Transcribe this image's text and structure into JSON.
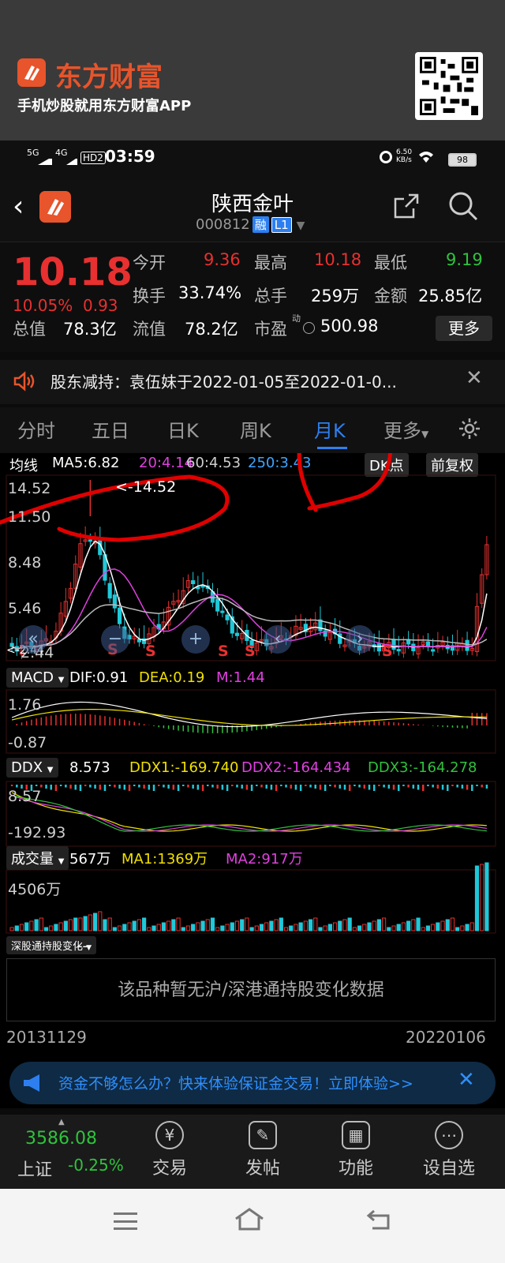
{
  "banner": {
    "brand": "东方财富",
    "slogan": "手机炒股就用东方财富APP"
  },
  "status_bar": {
    "net1": "5G",
    "net2": "4G",
    "hd": "HD2",
    "time": "03:59",
    "speed": "6.50 KB/s",
    "battery": "98"
  },
  "header": {
    "title": "陕西金叶",
    "code": "000812",
    "tag_margin": "融",
    "tag_level": "L1"
  },
  "quote": {
    "price": "10.18",
    "change_pct": "10.05%",
    "change": "0.93",
    "labels": [
      "今开",
      "最高",
      "最低",
      "换手",
      "总手",
      "金额",
      "总值",
      "流值",
      "市盈"
    ],
    "open": "9.36",
    "high": "10.18",
    "low": "9.19",
    "turnover": "33.74%",
    "volume": "259万",
    "amount": "25.85亿",
    "market_cap": "78.3亿",
    "float_cap": "78.2亿",
    "pe_sup": "动",
    "pe": "500.98",
    "more": "更多"
  },
  "notice": {
    "text": "股东减持：袁伍妹于2022-01-05至2022-01-0..."
  },
  "tabs": [
    "分时",
    "五日",
    "日K",
    "周K",
    "月K",
    "更多"
  ],
  "chart": {
    "ma_label": "均线",
    "ma5": "MA5:6.82",
    "ma20": "20:4.14",
    "ma60": "60:4.53",
    "ma250": "250:3.43",
    "dk_btn": "DK点",
    "adjust_btn": "前复权",
    "y_ticks": [
      "14.52",
      "11.50",
      "8.48",
      "5.46",
      "2.44"
    ],
    "max_marker": "<-14.52",
    "min_marker": "<-2.44",
    "s_marks": [
      "S",
      "S",
      "S",
      "S",
      "S"
    ],
    "macd": {
      "name": "MACD",
      "dif": "DIF:0.91",
      "dea": "DEA:0.19",
      "m": "M:1.44",
      "ticks": [
        "1.76",
        "-0.87"
      ]
    },
    "ddx": {
      "name": "DDX",
      "val": "8.573",
      "ddx1": "DDX1:-169.740",
      "ddx2": "DDX2:-164.434",
      "ddx3": "DDX3:-164.278",
      "ticks": [
        "8.57",
        "-192.93"
      ]
    },
    "vol": {
      "name": "成交量",
      "val": "567万",
      "ma1": "MA1:1369万",
      "ma2": "MA2:917万",
      "tick": "4506万"
    },
    "hk": {
      "name": "深股通持股变化",
      "val": "--",
      "empty": "该品种暂无沪/深港通持股变化数据"
    },
    "start_date": "20131129",
    "end_date": "20220106"
  },
  "ad": {
    "text": "资金不够怎么办？快来体验保证金交易！立即体验>>"
  },
  "bottom": {
    "index_value": "3586.08",
    "index_name": "上证",
    "index_change": "-0.25%",
    "items": [
      "交易",
      "发帖",
      "功能",
      "设自选"
    ]
  },
  "colors": {
    "up": "#e83030",
    "down": "#2fc33d",
    "accent": "#2d7ff0",
    "brand": "#e8542b"
  }
}
